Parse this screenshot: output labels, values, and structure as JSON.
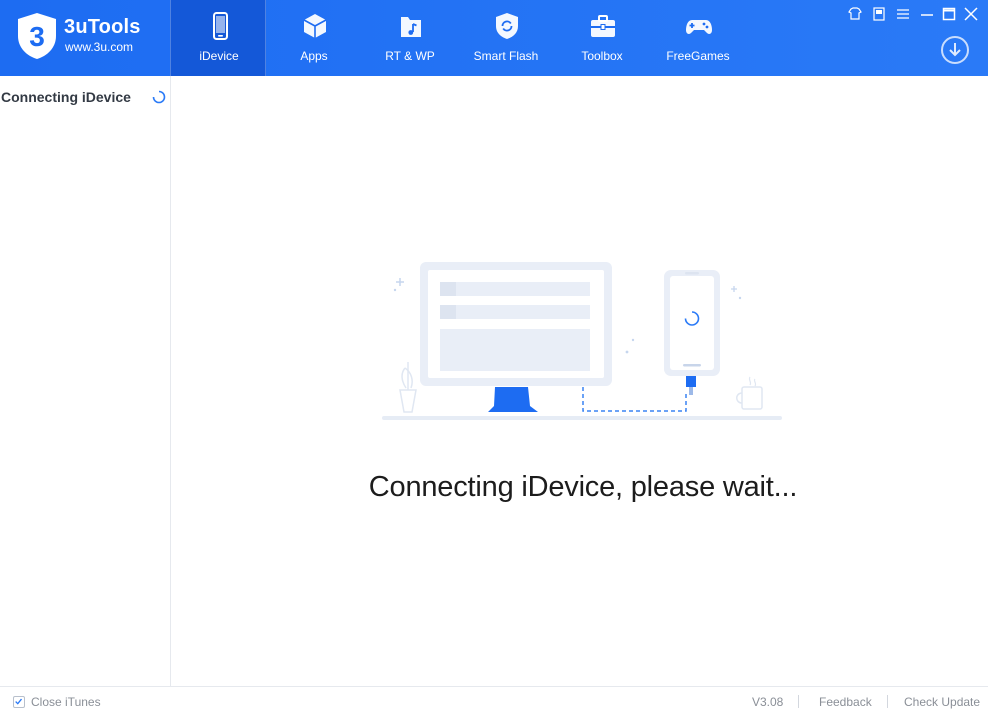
{
  "app": {
    "name": "3uTools",
    "url": "www.3u.com",
    "logo_mark": "3"
  },
  "nav": {
    "tabs": [
      {
        "label": "iDevice",
        "icon": "phone-icon",
        "active": true
      },
      {
        "label": "Apps",
        "icon": "box-icon",
        "active": false
      },
      {
        "label": "RT & WP",
        "icon": "music-folder-icon",
        "active": false
      },
      {
        "label": "Smart Flash",
        "icon": "shield-refresh-icon",
        "active": false
      },
      {
        "label": "Toolbox",
        "icon": "toolbox-icon",
        "active": false
      },
      {
        "label": "FreeGames",
        "icon": "gamepad-icon",
        "active": false
      }
    ]
  },
  "window_controls": [
    "skin-icon",
    "restore-icon",
    "menu-icon",
    "minimize-icon",
    "maximize-icon",
    "close-icon"
  ],
  "sidebar": {
    "title": "Connecting iDevice"
  },
  "main": {
    "status_message": "Connecting iDevice, please wait..."
  },
  "footer": {
    "close_itunes_label": "Close iTunes",
    "close_itunes_checked": true,
    "version": "V3.08",
    "feedback_label": "Feedback",
    "check_update_label": "Check Update"
  },
  "colors": {
    "header_blue": "#1d6cf2",
    "active_tab": "#1458d8",
    "accent": "#2a7af7",
    "illustration_bg": "#e9eef7"
  }
}
